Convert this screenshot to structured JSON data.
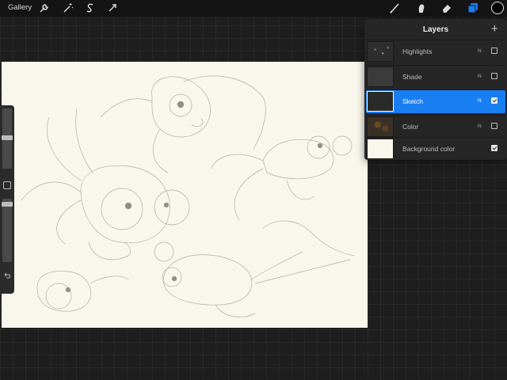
{
  "toolbar": {
    "gallery_label": "Gallery",
    "left_tools": [
      "wrench-icon",
      "magic-wand-icon",
      "selection-s-icon",
      "transform-arrow-icon"
    ],
    "right_tools": [
      "brush-icon",
      "smudge-icon",
      "eraser-icon",
      "layers-icon"
    ],
    "active_tool": "layers-icon",
    "current_color": "#000000",
    "accent_color": "#1a7ef3"
  },
  "layers_panel": {
    "title": "Layers",
    "add_label": "+",
    "layers": [
      {
        "name": "Highlights",
        "blend": "N",
        "visible": false,
        "selected": false
      },
      {
        "name": "Shade",
        "blend": "N",
        "visible": false,
        "selected": false
      },
      {
        "name": "Sketch",
        "blend": "N",
        "visible": true,
        "selected": true
      },
      {
        "name": "Color",
        "blend": "N",
        "visible": false,
        "selected": false
      },
      {
        "name": "Background color",
        "blend": "",
        "visible": true,
        "selected": false
      }
    ]
  },
  "canvas": {
    "background_color": "#f9f7eb",
    "subject": "pencil sketch of goldfish"
  },
  "sidebar": {
    "icons": [
      "brush-size-slider",
      "modify-button",
      "opacity-slider",
      "undo-icon"
    ]
  }
}
